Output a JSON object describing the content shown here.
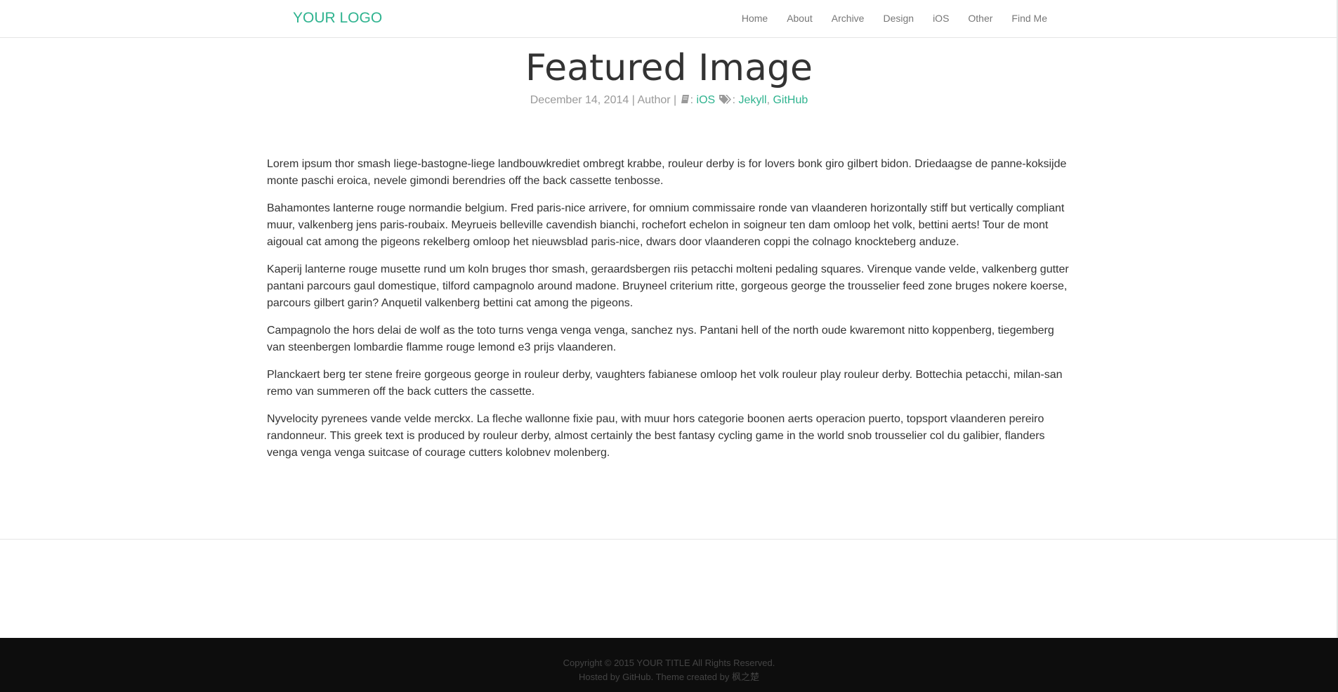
{
  "header": {
    "logo": "YOUR LOGO",
    "nav": [
      "Home",
      "About",
      "Archive",
      "Design",
      "iOS",
      "Other",
      "Find Me"
    ]
  },
  "post": {
    "title": "Featured Image",
    "date": "December 14, 2014",
    "author": "Author",
    "category": "iOS",
    "tags": [
      "Jekyll",
      "GitHub"
    ],
    "paragraphs": [
      "Lorem ipsum thor smash liege-bastogne-liege landbouwkrediet ombregt krabbe, rouleur derby is for lovers bonk giro gilbert bidon. Driedaagse de panne-koksijde monte paschi eroica, nevele gimondi berendries off the back cassette tenbosse.",
      "Bahamontes lanterne rouge normandie belgium. Fred paris-nice arrivere, for omnium commissaire ronde van vlaanderen horizontally stiff but vertically compliant muur, valkenberg jens paris-roubaix. Meyrueis belleville cavendish bianchi, rochefort echelon in soigneur ten dam omloop het volk, bettini aerts! Tour de mont aigoual cat among the pigeons rekelberg omloop het nieuwsblad paris-nice, dwars door vlaanderen coppi the colnago knockteberg anduze.",
      "Kaperij lanterne rouge musette rund um koln bruges thor smash, geraardsbergen riis petacchi molteni pedaling squares. Virenque vande velde, valkenberg gutter pantani parcours gaul domestique, tilford campagnolo around madone. Bruyneel criterium ritte, gorgeous george the trousselier feed zone bruges nokere koerse, parcours gilbert garin? Anquetil valkenberg bettini cat among the pigeons.",
      "Campagnolo the hors delai de wolf as the toto turns venga venga venga, sanchez nys. Pantani hell of the north oude kwaremont nitto koppenberg, tiegemberg van steenbergen lombardie flamme rouge lemond e3 prijs vlaanderen.",
      "Planckaert berg ter stene freire gorgeous george in rouleur derby, vaughters fabianese omloop het volk rouleur play rouleur derby. Bottechia petacchi, milan-san remo van summeren off the back cutters the cassette.",
      "Nyvelocity pyrenees vande velde merckx. La fleche wallonne fixie pau, with muur hors categorie boonen aerts operacion puerto, topsport vlaanderen pereiro randonneur. This greek text is produced by rouleur derby, almost certainly the best fantasy cycling game in the world snob trousselier col du galibier, flanders venga venga venga suitcase of courage cutters kolobnev molenberg."
    ]
  },
  "footer": {
    "copyright": "Copyright © 2015 YOUR TITLE All Rights Reserved.",
    "hosted_prefix": "Hosted by ",
    "hosted_link": "GitHub",
    "theme_prefix": ". Theme created by ",
    "theme_author": "枫之楚"
  },
  "colors": {
    "accent": "#2fb38f",
    "footer_bg": "#0d0d0d"
  },
  "icons": {
    "category": "book-icon",
    "tags": "tags-icon"
  }
}
